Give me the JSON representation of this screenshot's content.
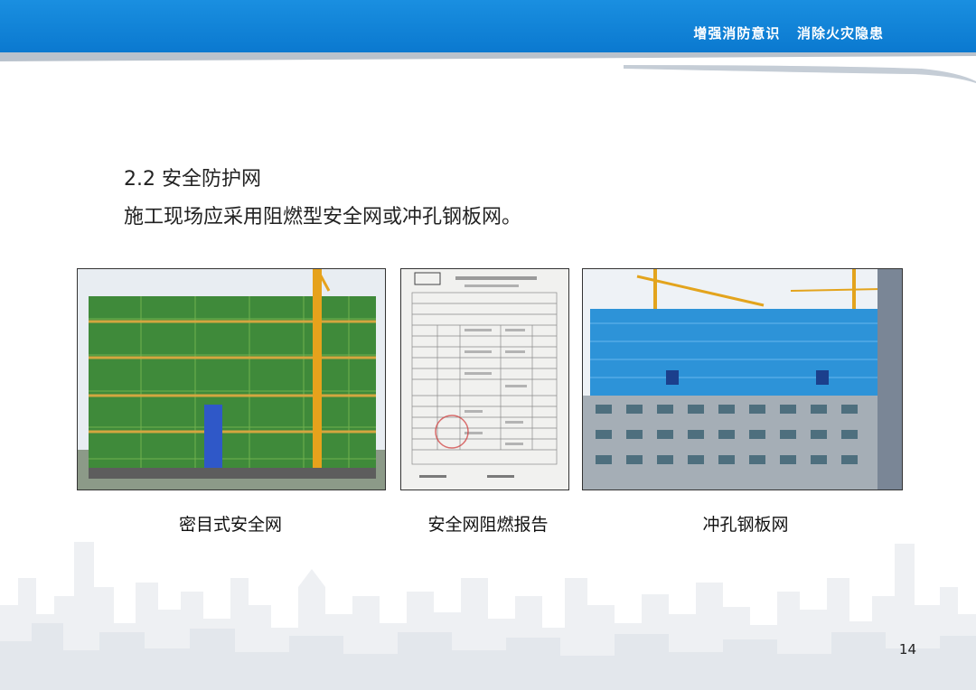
{
  "header": {
    "slogan": "增强消防意识   消除火灾隐患",
    "bar_color": "#0a78cf"
  },
  "section": {
    "heading": "2.2  安全防护网",
    "text": "施工现场应采用阻燃型安全网或冲孔钢板网。"
  },
  "figures": [
    {
      "caption": "密目式安全网",
      "icon": "green-netted-building-photo"
    },
    {
      "caption": "安全网阻燃报告",
      "icon": "test-report-document-photo"
    },
    {
      "caption": "冲孔钢板网",
      "icon": "blue-steel-mesh-building-photo"
    }
  ],
  "page_number": "14"
}
